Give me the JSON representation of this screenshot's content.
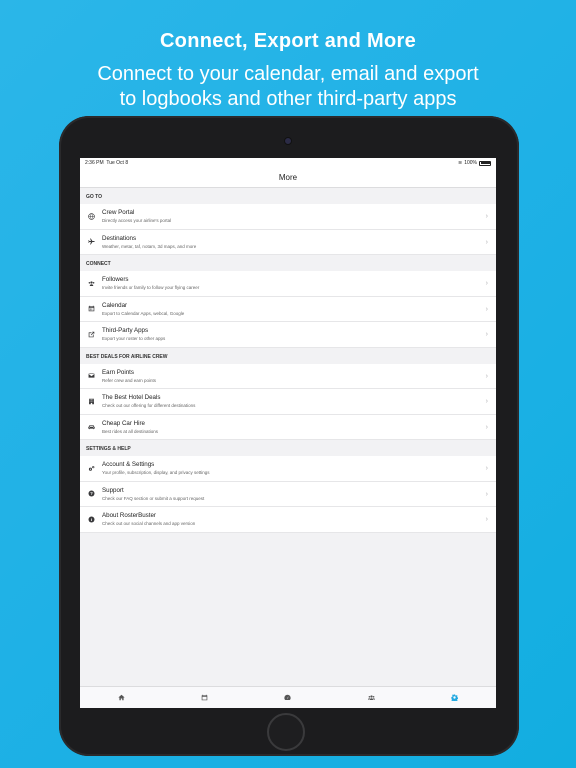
{
  "headline": {
    "title": "Connect, Export and More",
    "subtitle_line1": "Connect to your calendar, email and export",
    "subtitle_line2": "to logbooks and other third-party apps"
  },
  "status_bar": {
    "time": "2:36 PM",
    "date": "Tue Oct 8",
    "battery": "100%"
  },
  "nav": {
    "title": "More"
  },
  "sections": [
    {
      "header": "GO TO",
      "items": [
        {
          "title": "Crew Portal",
          "subtitle": "Directly access your airline's portal",
          "icon": "globe-icon"
        },
        {
          "title": "Destinations",
          "subtitle": "Weather, metar, taf, notam, 3d maps, and more",
          "icon": "airplane-icon"
        }
      ]
    },
    {
      "header": "CONNECT",
      "items": [
        {
          "title": "Followers",
          "subtitle": "Invite friends or family to follow your flying career",
          "icon": "users-icon"
        },
        {
          "title": "Calendar",
          "subtitle": "Export to Calendar Apps, webcal, Google",
          "icon": "calendar-icon"
        },
        {
          "title": "Third-Party Apps",
          "subtitle": "Export your roster to other apps",
          "icon": "external-link-icon"
        }
      ]
    },
    {
      "header": "BEST DEALS FOR AIRLINE CREW",
      "items": [
        {
          "title": "Earn Points",
          "subtitle": "Refer crew and earn points",
          "icon": "envelope-icon"
        },
        {
          "title": "The Best Hotel Deals",
          "subtitle": "Check out our offering for different destinations",
          "icon": "hotel-icon"
        },
        {
          "title": "Cheap Car Hire",
          "subtitle": "Best rides at all destinations",
          "icon": "car-icon"
        }
      ]
    },
    {
      "header": "SETTINGS & HELP",
      "items": [
        {
          "title": "Account & Settings",
          "subtitle": "Your profile, subscription, display, and privacy settings",
          "icon": "gears-icon"
        },
        {
          "title": "Support",
          "subtitle": "Check our FAQ section or submit a support request",
          "icon": "question-icon"
        },
        {
          "title": "About RosterBuster",
          "subtitle": "Check out our social channels and app version",
          "icon": "info-icon"
        }
      ]
    }
  ],
  "tabs": [
    {
      "name": "home-icon",
      "active": false
    },
    {
      "name": "calendar-icon",
      "active": false
    },
    {
      "name": "dashboard-icon",
      "active": false
    },
    {
      "name": "users-icon",
      "active": false
    },
    {
      "name": "gear-icon",
      "active": true
    }
  ],
  "colors": {
    "background": "#1fb1e6",
    "accent": "#20a8e0"
  }
}
